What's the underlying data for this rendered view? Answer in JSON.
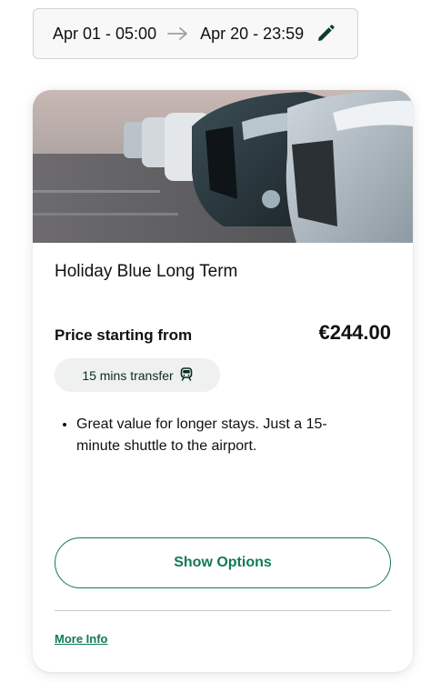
{
  "date_range": {
    "start": "Apr 01 - 05:00",
    "end": "Apr 20 - 23:59",
    "arrow_icon": "arrow-right-icon",
    "edit_icon": "pencil-icon"
  },
  "card": {
    "image_description_icon": "parked-cars-photo",
    "title": "Holiday Blue Long Term",
    "price_label": "Price starting from",
    "price": "€244.00",
    "transfer": {
      "label": "15 mins transfer",
      "icon": "train-icon"
    },
    "features": [
      "Great value for longer stays. Just a 15-minute shuttle to the airport."
    ],
    "show_options_label": "Show Options",
    "more_info_label": "More Info"
  },
  "colors": {
    "accent": "#12795a",
    "chip_bg": "#eef1ef",
    "date_bar_bg": "#f7f8f7"
  }
}
